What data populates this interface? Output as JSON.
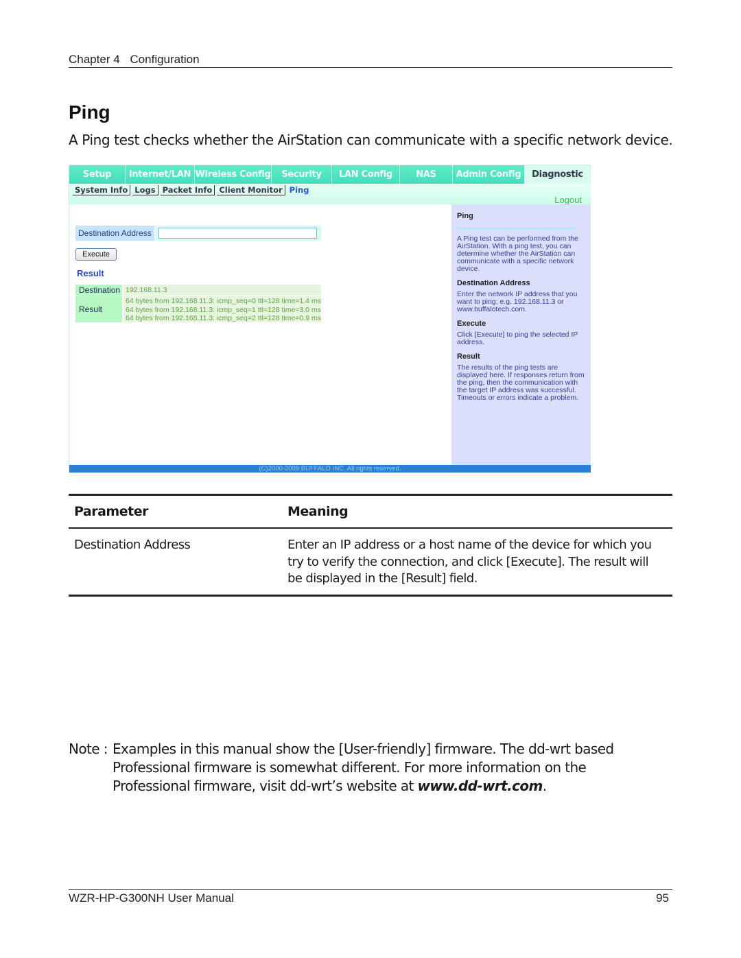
{
  "header": {
    "chapter": "Chapter 4",
    "section": "Configuration"
  },
  "title": "Ping",
  "intro": "A Ping test checks whether the AirStation can communicate with a specific network device.",
  "screenshot": {
    "nav_tabs": [
      {
        "label": "Setup"
      },
      {
        "label": "Internet/LAN"
      },
      {
        "label": "Wireless Config"
      },
      {
        "label": "Security"
      },
      {
        "label": "LAN Config"
      },
      {
        "label": "NAS"
      },
      {
        "label": "Admin Config"
      },
      {
        "label": "Diagnostic",
        "active": true
      }
    ],
    "sub_tabs": [
      {
        "label": "System Info"
      },
      {
        "label": "Logs"
      },
      {
        "label": "Packet Info"
      },
      {
        "label": "Client Monitor"
      },
      {
        "label": "Ping",
        "active": true
      }
    ],
    "logout": "Logout",
    "form": {
      "destination_label": "Destination Address",
      "destination_value": "",
      "execute_label": "Execute",
      "result_title": "Result"
    },
    "result_table": {
      "destination_label": "Destination",
      "destination_value": "192.168.11.3",
      "result_label": "Result",
      "result_lines": [
        "64 bytes from 192.168.11.3: icmp_seq=0 ttl=128 time=1.4 ms",
        "64 bytes from 192.168.11.3: icmp_seq=1 ttl=128 time=3.0 ms",
        "64 bytes from 192.168.11.3: icmp_seq=2 ttl=128 time=0.9 ms"
      ]
    },
    "help": {
      "title": "Ping",
      "intro": "A Ping test can be performed from the AirStation. With a ping test, you can determine whether the AirStation can communicate with a specific network device.",
      "sections": [
        {
          "heading": "Destination Address",
          "text": "Enter the network IP address that you want to ping; e.g. 192.168.11.3 or www.buffalotech.com."
        },
        {
          "heading": "Execute",
          "text": "Click [Execute] to ping the selected IP address."
        },
        {
          "heading": "Result",
          "text": "The results of the ping tests are displayed here. If responses return from the ping, then the communication with the target IP address was successful. Timeouts or errors indicate a problem."
        }
      ]
    },
    "copyright": "(C)2000-2009 BUFFALO INC. All rights reserved."
  },
  "param_table": {
    "headers": {
      "parameter": "Parameter",
      "meaning": "Meaning"
    },
    "rows": [
      {
        "parameter": "Destination Address",
        "meaning": "Enter an IP address or a host name of the device for which you try to verify the connection, and click [Execute]. The result will be displayed in the [Result] field."
      }
    ]
  },
  "note": {
    "label": "Note :",
    "text": "Examples in this manual show the [User-friendly] firmware. The dd-wrt based Professional firmware is somewhat different. For more information on the Professional firmware, visit dd-wrt’s website at ",
    "url": "www.dd-wrt.com",
    "end": "."
  },
  "footer": {
    "manual": "WZR-HP-G300NH User Manual",
    "page": "95"
  },
  "colors": {
    "nav_tab": "#4fe3c0",
    "help_panel": "#dcdffb",
    "footer_bar": "#2b7fd4",
    "logout": "#3cc24a"
  }
}
